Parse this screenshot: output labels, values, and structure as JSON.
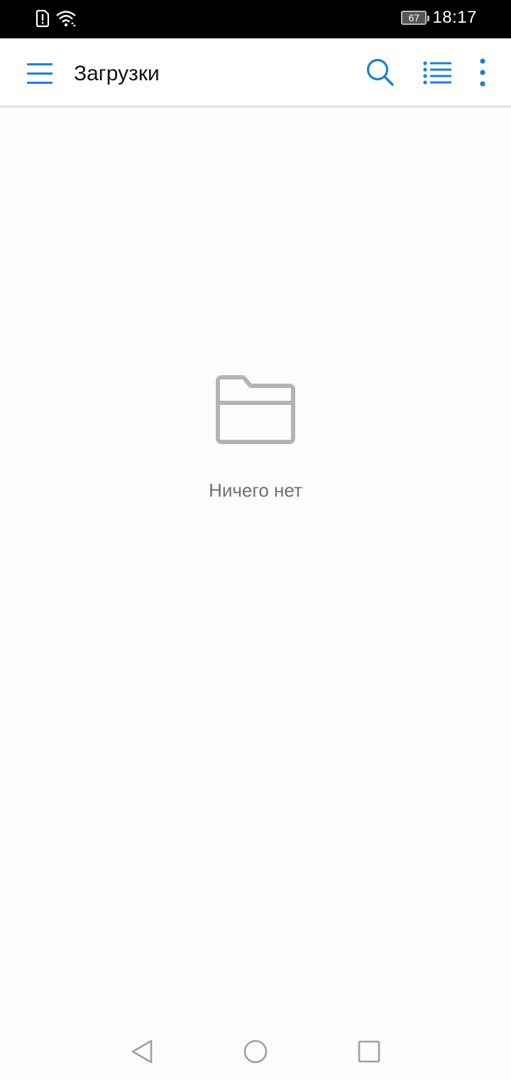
{
  "status_bar": {
    "time": "18:17",
    "battery_level": "67",
    "icons": [
      "sim-alert-icon",
      "wifi-icon",
      "battery-icon"
    ]
  },
  "app_bar": {
    "title": "Загрузки",
    "actions": [
      "menu-icon",
      "search-icon",
      "list-view-icon",
      "more-vert-icon"
    ],
    "accent_color": "#1a7fd9"
  },
  "empty_state": {
    "icon": "folder-icon",
    "message": "Ничего нет",
    "icon_color": "#b3b3b3"
  },
  "nav_bar": {
    "buttons": [
      "back-icon",
      "home-icon",
      "recent-apps-icon"
    ]
  }
}
